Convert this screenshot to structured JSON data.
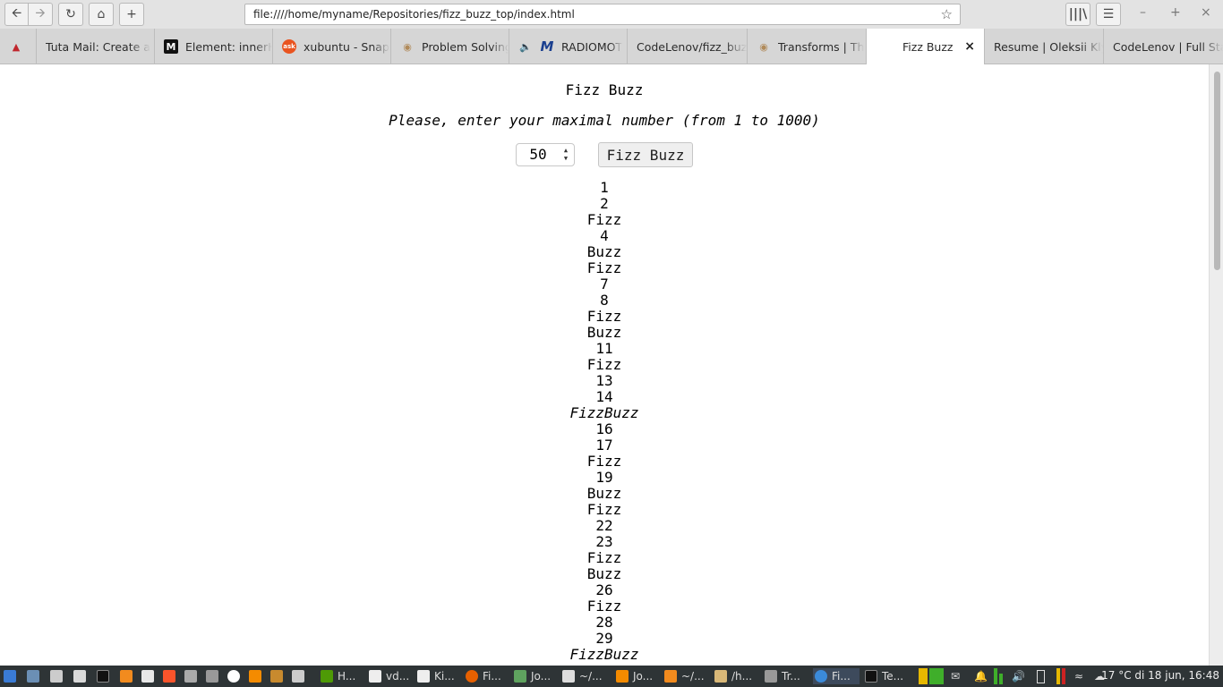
{
  "window": {
    "url": "file:////home/myname/Repositories/fizz_buzz_top/index.html"
  },
  "toolbar": {
    "back_icon": "arrow-left-icon",
    "forward_icon": "arrow-right-icon",
    "reload_icon": "reload-icon",
    "home_icon": "home-icon",
    "new_tab_icon": "plus-icon",
    "bookmark_icon": "star-icon",
    "library_icon": "library-icon",
    "menu_icon": "hamburger-icon"
  },
  "tabs": [
    {
      "label": "",
      "icon": "red-logo-icon"
    },
    {
      "label": "Tuta Mail: Create a",
      "icon": "mail-icon"
    },
    {
      "label": "Element: innerH",
      "icon": "m-icon"
    },
    {
      "label": "xubuntu - Snap",
      "icon": "askubuntu-icon"
    },
    {
      "label": "Problem Solving",
      "icon": "owl-icon"
    },
    {
      "label": "RADIOMOT",
      "icon": "radio-icon"
    },
    {
      "label": "CodeLenov/fizz_buz",
      "icon": ""
    },
    {
      "label": "Transforms | Th",
      "icon": "owl-icon"
    },
    {
      "label": "Fizz Buzz",
      "icon": "",
      "active": true
    },
    {
      "label": "Resume | Oleksii Kly",
      "icon": ""
    },
    {
      "label": "CodeLenov | Full Sta",
      "icon": ""
    }
  ],
  "page": {
    "title": "Fizz Buzz",
    "prompt": "Please, enter your maximal number (from 1 to 1000)",
    "input_value": "50",
    "button_label": "Fizz Buzz",
    "results": [
      "1",
      "2",
      "Fizz",
      "4",
      "Buzz",
      "Fizz",
      "7",
      "8",
      "Fizz",
      "Buzz",
      "11",
      "Fizz",
      "13",
      "14",
      "FizzBuzz",
      "16",
      "17",
      "Fizz",
      "19",
      "Buzz",
      "Fizz",
      "22",
      "23",
      "Fizz",
      "Buzz",
      "26",
      "Fizz",
      "28",
      "29",
      "FizzBuzz"
    ]
  },
  "taskbar": {
    "items": [
      "H...",
      "vd...",
      "Ki...",
      "Fi...",
      "Jo...",
      "~/...",
      "Jo...",
      "~/...",
      "/h...",
      "Tr...",
      "Fi...",
      "Te..."
    ],
    "clock": "17 °C  di 18 jun, 16:48"
  }
}
